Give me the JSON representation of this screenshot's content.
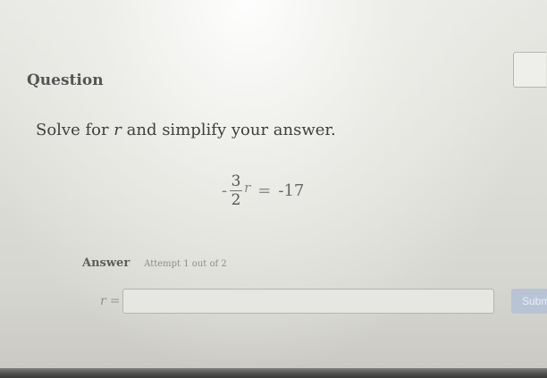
{
  "question": {
    "heading": "Question",
    "prompt_before": "Solve for ",
    "variable": "r",
    "prompt_after": " and simplify your answer.",
    "equation": {
      "sign": "-",
      "numerator": "3",
      "denominator": "2",
      "variable": "r",
      "equals": "=",
      "rhs": "-17"
    }
  },
  "answer": {
    "label": "Answer",
    "attempt_text": "Attempt 1 out of 2",
    "variable": "r",
    "equals": "=",
    "input_value": "",
    "submit_label": "Subm"
  }
}
